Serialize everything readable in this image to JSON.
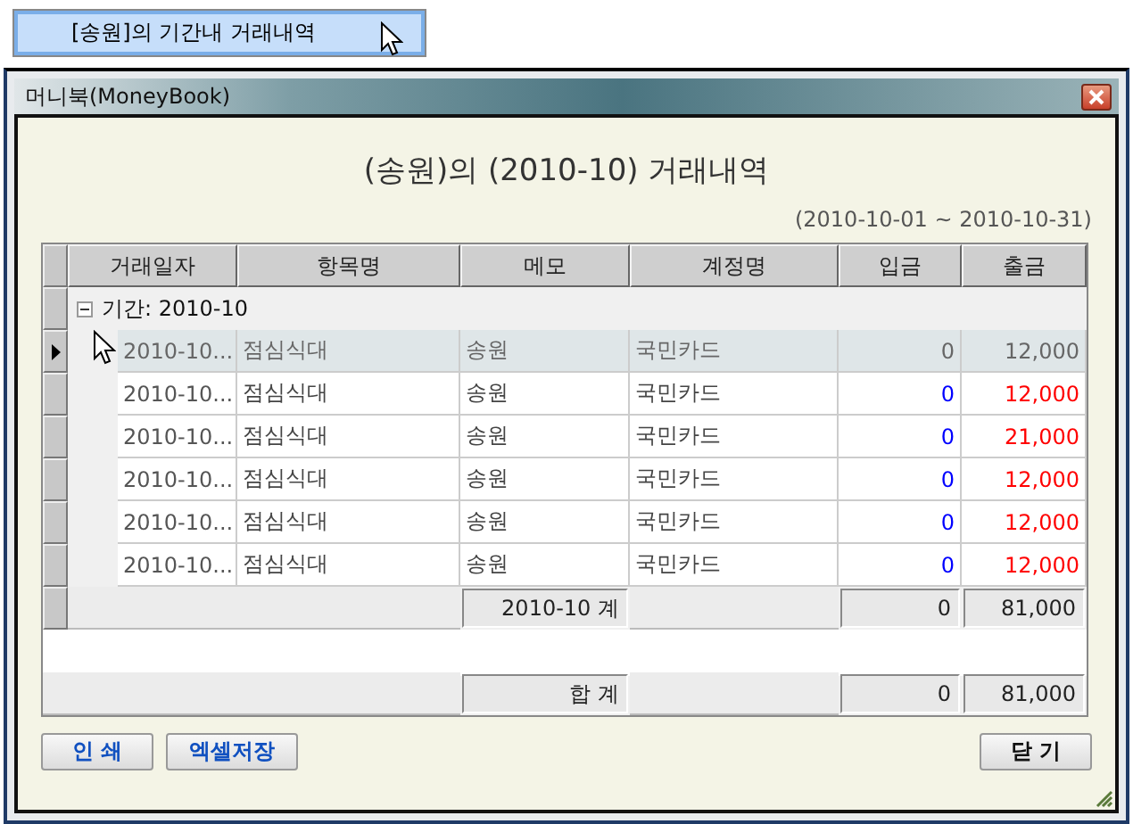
{
  "launcher_button": {
    "label": "[송원]의 기간내 거래내역"
  },
  "window": {
    "title": "머니북(MoneyBook)"
  },
  "report": {
    "title": "(송원)의 (2010-10) 거래내역",
    "range": "(2010-10-01 ~ 2010-10-31)"
  },
  "table": {
    "columns": [
      "거래일자",
      "항목명",
      "메모",
      "계정명",
      "입금",
      "출금"
    ],
    "group": {
      "label": "기간: 2010-10",
      "expanded": true
    },
    "rows": [
      {
        "date": "2010-10...",
        "item": "점심식대",
        "memo": "송원",
        "account": "국민카드",
        "deposit": "0",
        "withdrawal": "12,000",
        "selected": true
      },
      {
        "date": "2010-10...",
        "item": "점심식대",
        "memo": "송원",
        "account": "국민카드",
        "deposit": "0",
        "withdrawal": "12,000",
        "selected": false
      },
      {
        "date": "2010-10...",
        "item": "점심식대",
        "memo": "송원",
        "account": "국민카드",
        "deposit": "0",
        "withdrawal": "21,000",
        "selected": false
      },
      {
        "date": "2010-10...",
        "item": "점심식대",
        "memo": "송원",
        "account": "국민카드",
        "deposit": "0",
        "withdrawal": "12,000",
        "selected": false
      },
      {
        "date": "2010-10...",
        "item": "점심식대",
        "memo": "송원",
        "account": "국민카드",
        "deposit": "0",
        "withdrawal": "12,000",
        "selected": false
      },
      {
        "date": "2010-10...",
        "item": "점심식대",
        "memo": "송원",
        "account": "국민카드",
        "deposit": "0",
        "withdrawal": "12,000",
        "selected": false
      }
    ],
    "subtotal": {
      "label": "2010-10 계",
      "deposit": "0",
      "withdrawal": "81,000"
    },
    "total": {
      "label": "합 계",
      "deposit": "0",
      "withdrawal": "81,000"
    }
  },
  "footer": {
    "left_buttons": [
      "인 쇄",
      "엑셀저장"
    ],
    "close_button": "닫 기"
  }
}
